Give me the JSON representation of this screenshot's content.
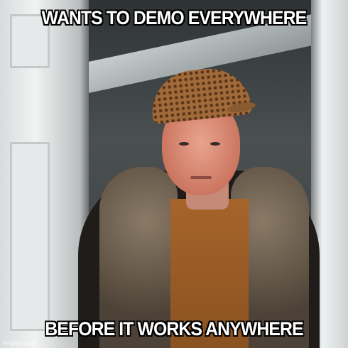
{
  "meme": {
    "top_text": "WANTS TO DEMO EVERYWHERE",
    "bottom_text": "BEFORE IT WORKS ANYWHERE",
    "watermark": "imgflip.com"
  }
}
